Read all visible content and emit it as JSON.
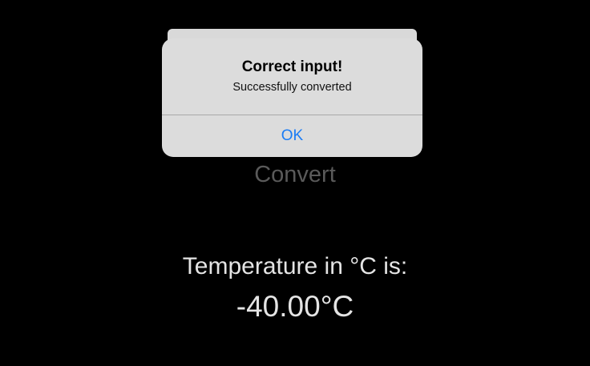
{
  "screen": {
    "convert_label": "Convert",
    "result_label": "Temperature in °C is:",
    "result_value": "-40.00°C"
  },
  "alert": {
    "title": "Correct input!",
    "message": "Successfully converted",
    "ok_label": "OK"
  },
  "colors": {
    "background": "#000000",
    "alert_background": "#dcdcdc",
    "ok_button": "#1a7cf5",
    "result_text": "#e4e4e4",
    "convert_text_dimmed": "#5a5a5a"
  }
}
